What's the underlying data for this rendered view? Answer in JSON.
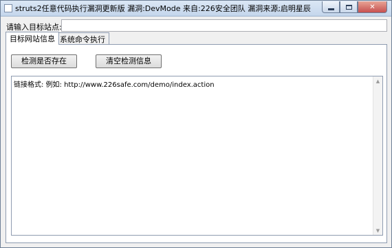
{
  "window": {
    "title": "struts2任意代码执行漏洞更新版 漏洞:DevMode 来自:226安全团队 漏洞来源;启明星辰",
    "minimize_symbol": "",
    "maximize_symbol": "",
    "close_symbol": "✕"
  },
  "target": {
    "label": "请输入目标站点:",
    "value": "",
    "placeholder": ""
  },
  "tabs": [
    {
      "label": "目标网站信息",
      "active": true
    },
    {
      "label": "系统命令执行",
      "active": false
    }
  ],
  "actions": {
    "check_label": "检测是否存在",
    "clear_label": "清空检测信息"
  },
  "output": {
    "text": "链接格式: 例如: http://www.226safe.com/demo/index.action"
  },
  "scrollbar": {
    "up_arrow": "▲",
    "down_arrow": "▼"
  }
}
